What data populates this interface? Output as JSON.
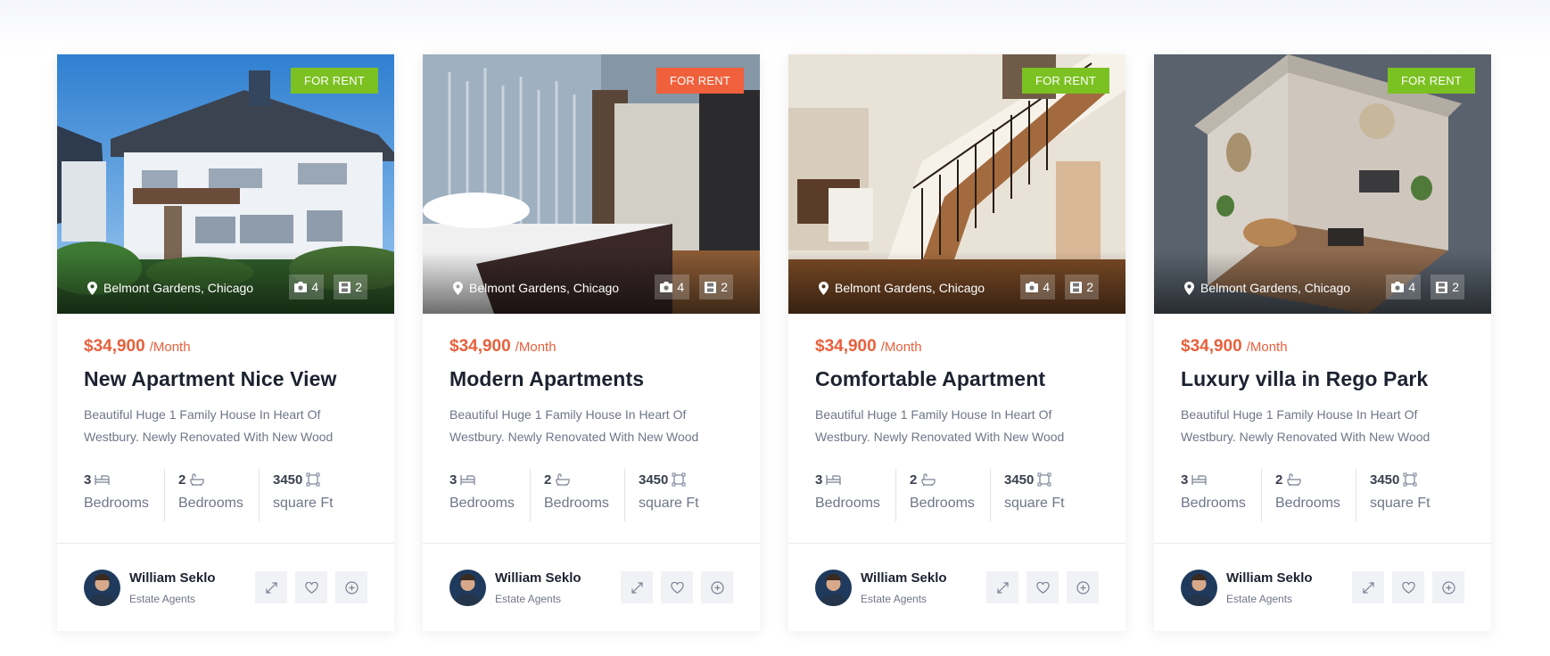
{
  "colors": {
    "accent": "#e8603c",
    "badge_green": "#7cc122",
    "badge_orange": "#f0603c",
    "title": "#1d2230",
    "muted": "#6f7688"
  },
  "listings": [
    {
      "badge": "FOR RENT",
      "badge_color": "#7cc122",
      "location": "Belmont Gardens, Chicago",
      "photos": "4",
      "videos": "2",
      "price": "$34,900",
      "price_unit": "/Month",
      "title": "New Apartment Nice View",
      "description": "Beautiful Huge 1 Family House In Heart Of Westbury. Newly Renovated With New Wood",
      "stats": [
        {
          "value": "3",
          "label": "Bedrooms",
          "icon": "bed-icon"
        },
        {
          "value": "2",
          "label": "Bedrooms",
          "icon": "bath-icon"
        },
        {
          "value": "3450",
          "label": "square Ft",
          "icon": "area-icon"
        }
      ],
      "agent": {
        "name": "William Seklo",
        "role": "Estate Agents"
      }
    },
    {
      "badge": "FOR RENT",
      "badge_color": "#f0603c",
      "location": "Belmont Gardens, Chicago",
      "photos": "4",
      "videos": "2",
      "price": "$34,900",
      "price_unit": "/Month",
      "title": "Modern Apartments",
      "description": "Beautiful Huge 1 Family House In Heart Of Westbury. Newly Renovated With New Wood",
      "stats": [
        {
          "value": "3",
          "label": "Bedrooms",
          "icon": "bed-icon"
        },
        {
          "value": "2",
          "label": "Bedrooms",
          "icon": "bath-icon"
        },
        {
          "value": "3450",
          "label": "square Ft",
          "icon": "area-icon"
        }
      ],
      "agent": {
        "name": "William Seklo",
        "role": "Estate Agents"
      }
    },
    {
      "badge": "FOR RENT",
      "badge_color": "#7cc122",
      "location": "Belmont Gardens, Chicago",
      "photos": "4",
      "videos": "2",
      "price": "$34,900",
      "price_unit": "/Month",
      "title": "Comfortable Apartment",
      "description": "Beautiful Huge 1 Family House In Heart Of Westbury. Newly Renovated With New Wood",
      "stats": [
        {
          "value": "3",
          "label": "Bedrooms",
          "icon": "bed-icon"
        },
        {
          "value": "2",
          "label": "Bedrooms",
          "icon": "bath-icon"
        },
        {
          "value": "3450",
          "label": "square Ft",
          "icon": "area-icon"
        }
      ],
      "agent": {
        "name": "William Seklo",
        "role": "Estate Agents"
      }
    },
    {
      "badge": "FOR RENT",
      "badge_color": "#7cc122",
      "location": "Belmont Gardens, Chicago",
      "photos": "4",
      "videos": "2",
      "price": "$34,900",
      "price_unit": "/Month",
      "title": "Luxury villa in Rego Park",
      "description": "Beautiful Huge 1 Family House In Heart Of Westbury. Newly Renovated With New Wood",
      "stats": [
        {
          "value": "3",
          "label": "Bedrooms",
          "icon": "bed-icon"
        },
        {
          "value": "2",
          "label": "Bedrooms",
          "icon": "bath-icon"
        },
        {
          "value": "3450",
          "label": "square Ft",
          "icon": "area-icon"
        }
      ],
      "agent": {
        "name": "William Seklo",
        "role": "Estate Agents"
      }
    }
  ]
}
